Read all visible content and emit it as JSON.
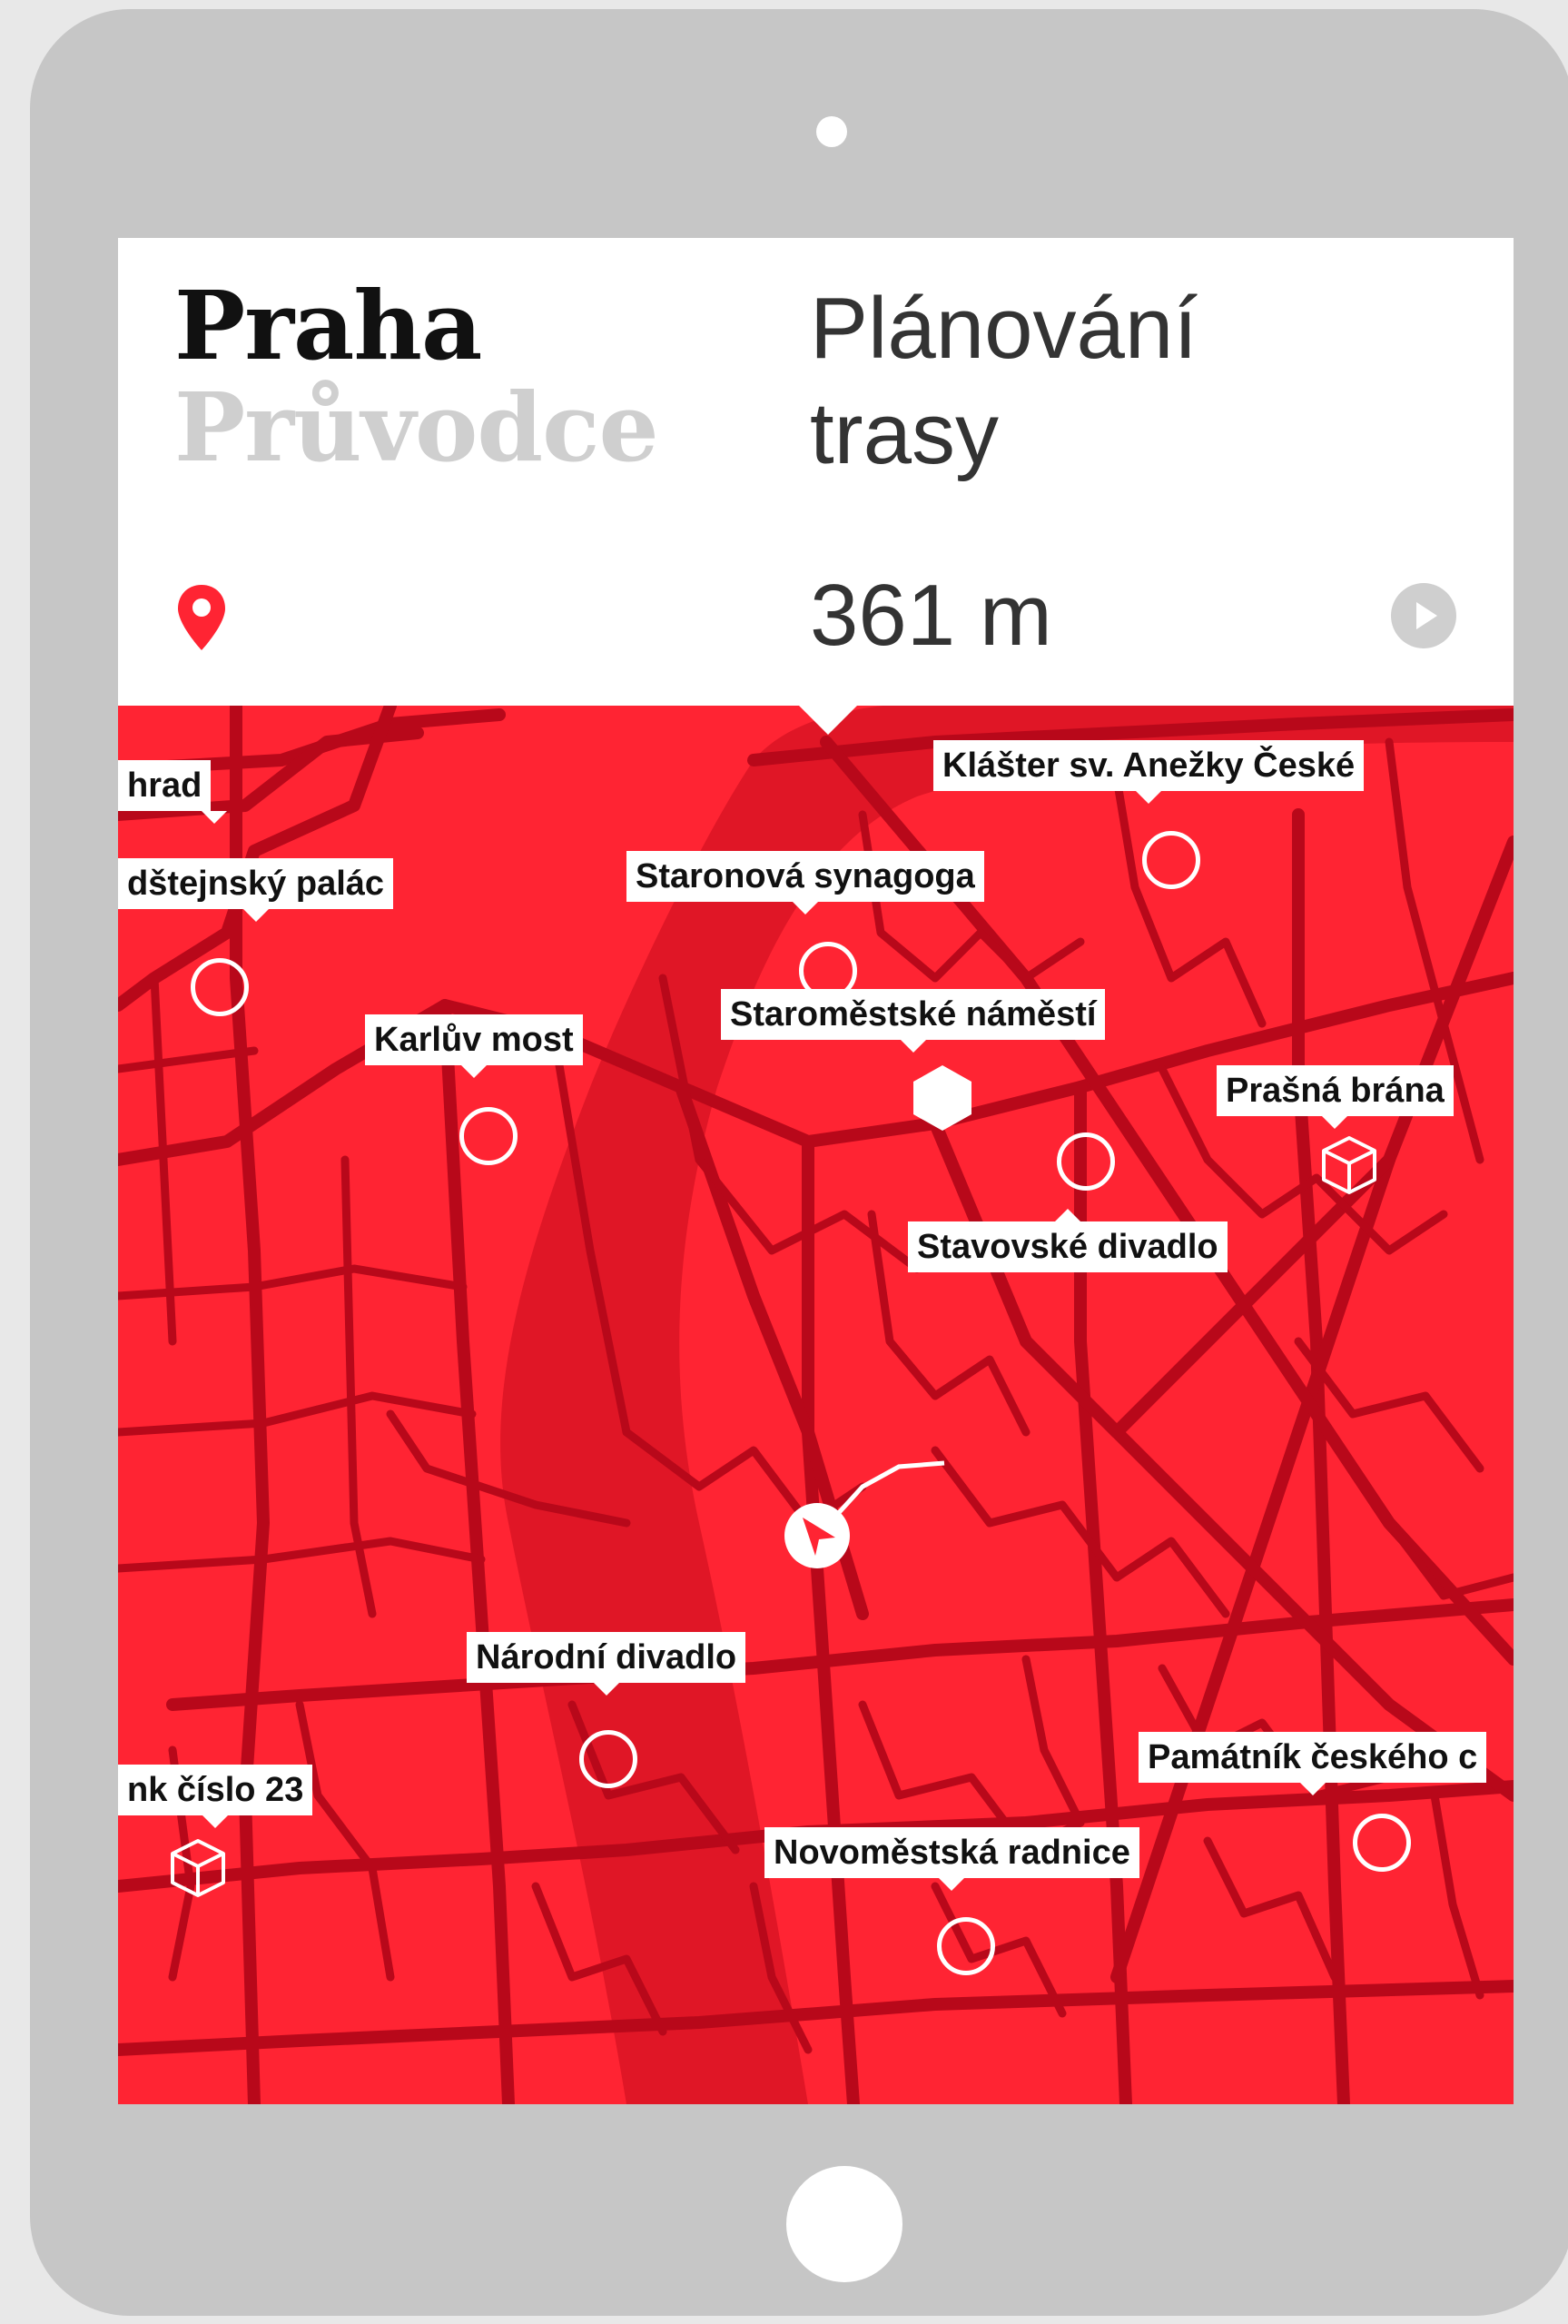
{
  "app": {
    "title": "Praha",
    "subtitle": "Průvodce"
  },
  "header": {
    "heading": "Plánování trasy",
    "distance": "361 m"
  },
  "icons": {
    "location": "location-pin-icon",
    "play": "play-circle-icon"
  },
  "colors": {
    "accent": "#ff2433",
    "road": "#b8081a",
    "river": "#e01626"
  },
  "map": {
    "pois": [
      {
        "label": "Klášter sv. Anežky České",
        "marker": "circle"
      },
      {
        "label": "hrad",
        "marker": "none"
      },
      {
        "label": "Staronová synagoga",
        "marker": "circle"
      },
      {
        "label": "dštejnský palác",
        "marker": "circle"
      },
      {
        "label": "Karlův most",
        "marker": "circle"
      },
      {
        "label": "Staroměstské náměstí",
        "marker": "hexagon"
      },
      {
        "label": "Prašná brána",
        "marker": "cube"
      },
      {
        "label": "Stavovské divadlo",
        "marker": "circle"
      },
      {
        "label": "Národní divadlo",
        "marker": "circle"
      },
      {
        "label": "Památník českého c",
        "marker": "circle"
      },
      {
        "label": "nk číslo 23",
        "marker": "cube"
      },
      {
        "label": "Novoměstská radnice",
        "marker": "circle"
      }
    ]
  }
}
